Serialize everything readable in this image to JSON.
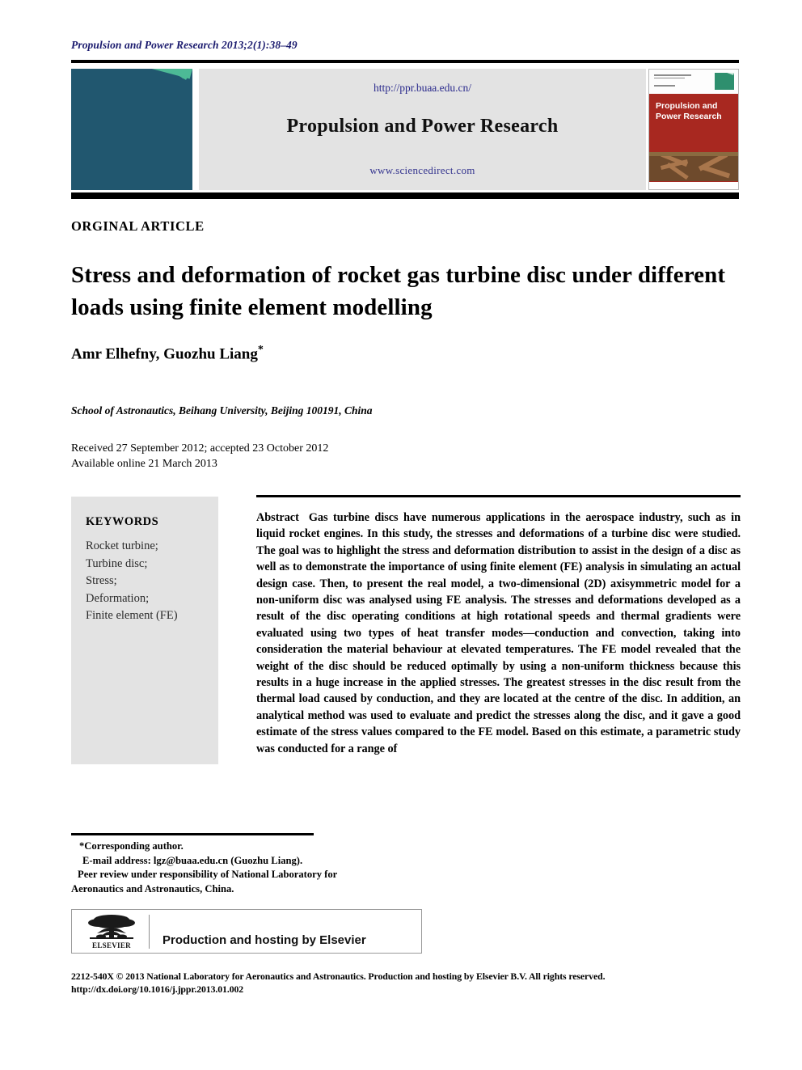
{
  "running_head": "Propulsion and Power Research 2013;2(1):38–49",
  "banner": {
    "url_top": "http://ppr.buaa.edu.cn/",
    "journal_title": "Propulsion and Power Research",
    "url_bottom": "www.sciencedirect.com",
    "logo_name": "journal-fan-logo",
    "cover_title": "Propulsion and Power Research"
  },
  "article": {
    "type": "ORGINAL ARTICLE",
    "title": "Stress and deformation of rocket gas turbine disc under different loads using finite element modelling",
    "authors": "Amr Elhefny, Guozhu Liang",
    "author_marker": "*",
    "affiliation": "School of Astronautics, Beihang University, Beijing 100191, China",
    "received": "Received 27 September 2012; accepted 23 October 2012",
    "available": "Available online 21 March 2013"
  },
  "keywords": {
    "heading": "KEYWORDS",
    "items": [
      "Rocket turbine;",
      "Turbine disc;",
      "Stress;",
      "Deformation;",
      "Finite element (FE)"
    ]
  },
  "abstract": {
    "label": "Abstract",
    "text": "Gas turbine discs have numerous applications in the aerospace industry, such as in liquid rocket engines. In this study, the stresses and deformations of a turbine disc were studied. The goal was to highlight the stress and deformation distribution to assist in the design of a disc as well as to demonstrate the importance of using finite element (FE) analysis in simulating an actual design case. Then, to present the real model, a two-dimensional (2D) axisymmetric model for a non-uniform disc was analysed using FE analysis. The stresses and deformations developed as a result of the disc operating conditions at high rotational speeds and thermal gradients were evaluated using two types of heat transfer modes—conduction and convection, taking into consideration the material behaviour at elevated temperatures. The FE model revealed that the weight of the disc should be reduced optimally by using a non-uniform thickness because this results in a huge increase in the applied stresses. The greatest stresses in the disc result from the thermal load caused by conduction, and they are located at the centre of the disc. In addition, an analytical method was used to evaluate and predict the stresses along the disc, and it gave a good estimate of the stress values compared to the FE model. Based on this estimate, a parametric study was conducted for a range of"
  },
  "footnotes": {
    "corresponding": "*Corresponding author.",
    "email": "E-mail address: lgz@buaa.edu.cn (Guozhu Liang).",
    "peer_review_line1": "Peer review under responsibility of National Laboratory for",
    "peer_review_line2": "Aeronautics and Astronautics, China."
  },
  "elsevier": {
    "label": "Production and hosting by Elsevier",
    "wordmark": "ELSEVIER"
  },
  "copyright": {
    "line1": "2212-540X © 2013 National Laboratory for Aeronautics and Astronautics. Production and hosting by Elsevier B.V. All rights reserved.",
    "line2": "http://dx.doi.org/10.1016/j.jppr.2013.01.002"
  }
}
